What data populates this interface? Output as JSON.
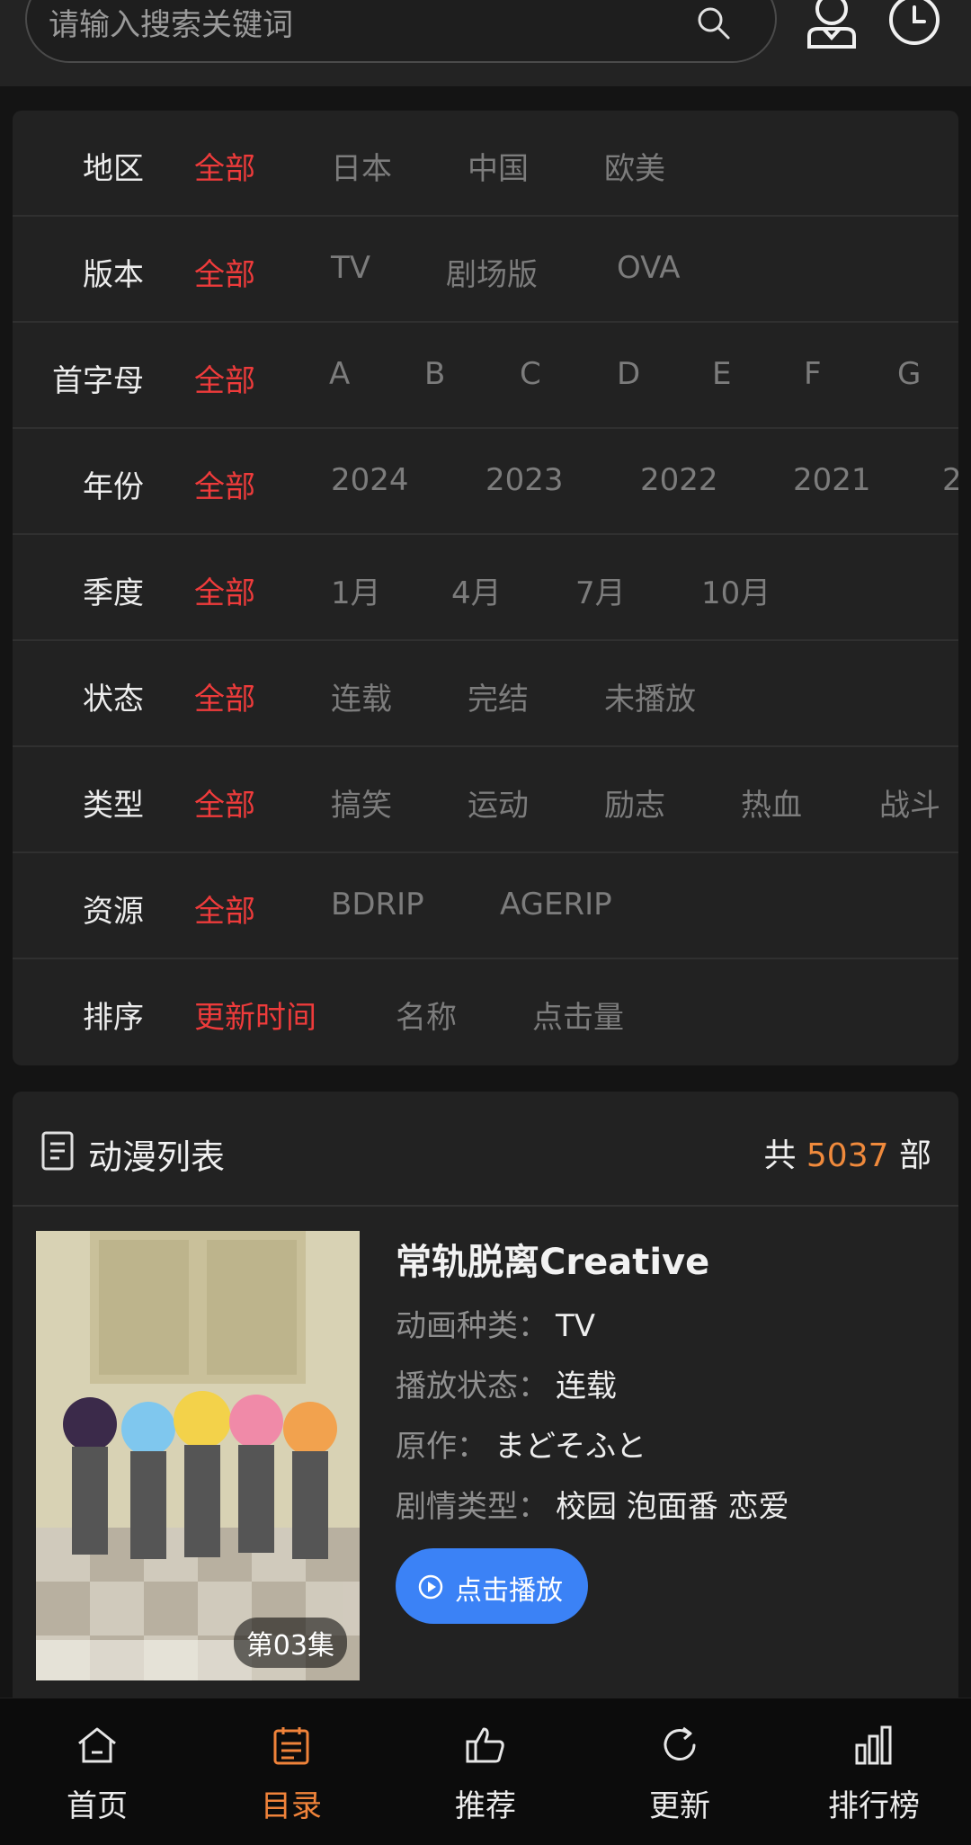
{
  "header": {
    "search_placeholder": "请输入搜索关键词",
    "icons": [
      "search-icon",
      "user-icon",
      "history-icon"
    ]
  },
  "filters": [
    {
      "label": "地区",
      "options": [
        "全部",
        "日本",
        "中国",
        "欧美"
      ],
      "selected": 0
    },
    {
      "label": "版本",
      "options": [
        "全部",
        "TV",
        "剧场版",
        "OVA"
      ],
      "selected": 0
    },
    {
      "label": "首字母",
      "options": [
        "全部",
        "A",
        "B",
        "C",
        "D",
        "E",
        "F",
        "G"
      ],
      "selected": 0
    },
    {
      "label": "年份",
      "options": [
        "全部",
        "2024",
        "2023",
        "2022",
        "2021",
        "2"
      ],
      "selected": 0
    },
    {
      "label": "季度",
      "options": [
        "全部",
        "1月",
        "4月",
        "7月",
        "10月"
      ],
      "selected": 0
    },
    {
      "label": "状态",
      "options": [
        "全部",
        "连载",
        "完结",
        "未播放"
      ],
      "selected": 0
    },
    {
      "label": "类型",
      "options": [
        "全部",
        "搞笑",
        "运动",
        "励志",
        "热血",
        "战斗"
      ],
      "selected": 0
    },
    {
      "label": "资源",
      "options": [
        "全部",
        "BDRIP",
        "AGERIP"
      ],
      "selected": 0
    },
    {
      "label": "排序",
      "options": [
        "更新时间",
        "名称",
        "点击量"
      ],
      "selected": 0
    }
  ],
  "list": {
    "title": "动漫列表",
    "count_prefix": "共",
    "count": "5037",
    "count_suffix": "部",
    "items": [
      {
        "name": "常轨脱离Creative",
        "episode_badge": "第03集",
        "fields": [
          {
            "key": "动画种类：",
            "value": "TV"
          },
          {
            "key": "播放状态：",
            "value": "连载"
          },
          {
            "key": "原作：",
            "value": "まどそふと"
          },
          {
            "key": "剧情类型：",
            "value": "校园 泡面番 恋爱"
          }
        ],
        "play_label": "点击播放"
      }
    ]
  },
  "bottom_nav": {
    "items": [
      {
        "label": "首页",
        "icon": "home-icon"
      },
      {
        "label": "目录",
        "icon": "catalog-icon"
      },
      {
        "label": "推荐",
        "icon": "thumbs-up-icon"
      },
      {
        "label": "更新",
        "icon": "refresh-icon"
      },
      {
        "label": "排行榜",
        "icon": "ranking-icon"
      }
    ],
    "active_index": 1
  },
  "colors": {
    "active_option": "#ee3b3b",
    "count_number": "#f08a3c",
    "play_button": "#3b82f6",
    "nav_active": "#f0833a"
  }
}
